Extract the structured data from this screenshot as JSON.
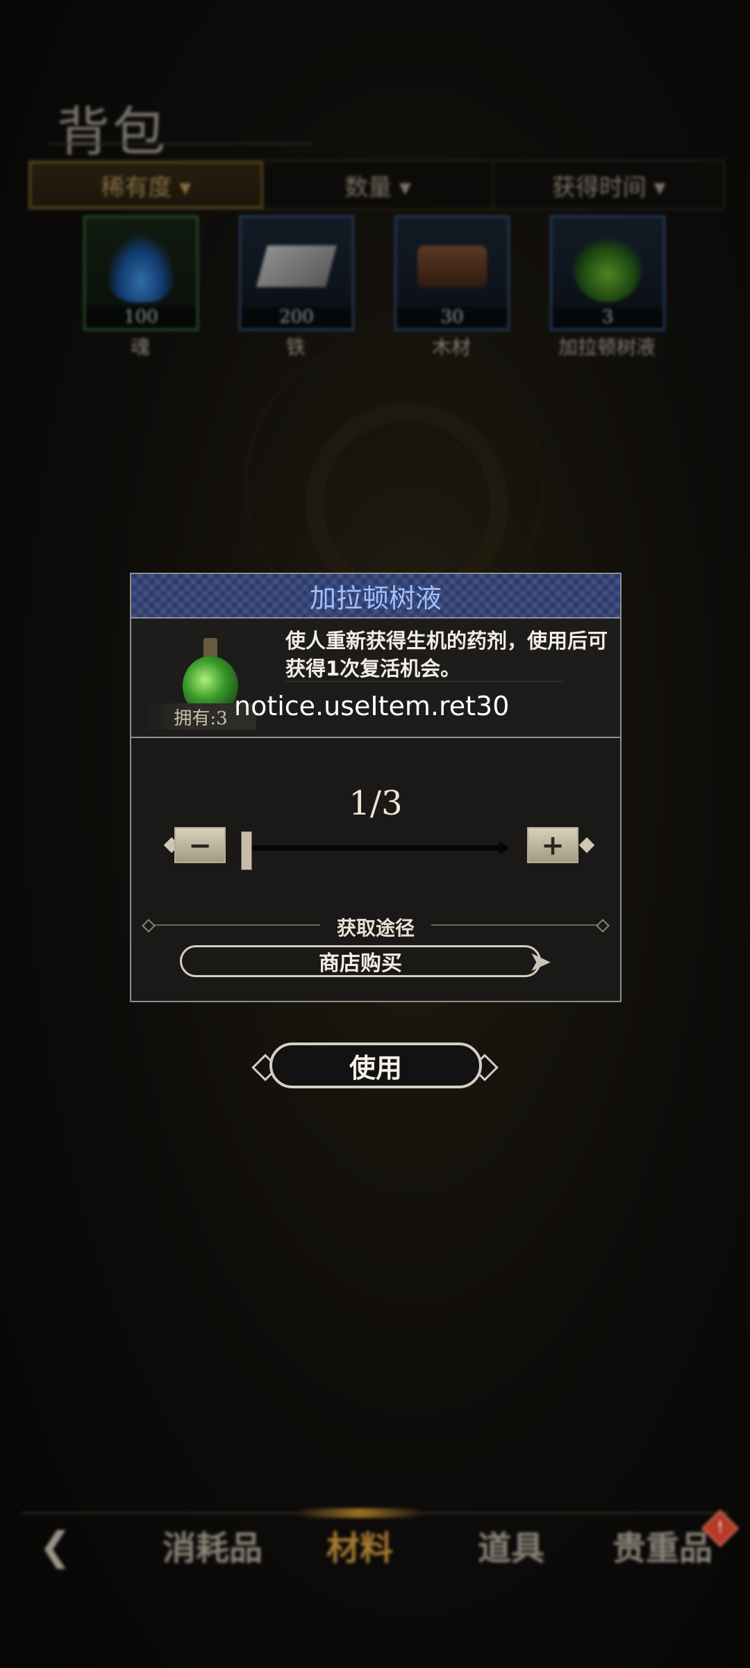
{
  "header": {
    "title": "背包"
  },
  "sort_tabs": [
    {
      "label": "稀有度 ▾",
      "active": true
    },
    {
      "label": "数量 ▾",
      "active": false
    },
    {
      "label": "获得时间 ▾",
      "active": false
    }
  ],
  "items": [
    {
      "count": "100",
      "name": "魂",
      "icon": "blue-flame-icon"
    },
    {
      "count": "200",
      "name": "铁",
      "icon": "iron-ingot-icon"
    },
    {
      "count": "30",
      "name": "木材",
      "icon": "wood-logs-icon"
    },
    {
      "count": "3",
      "name": "加拉顿树液",
      "icon": "potion-icon"
    }
  ],
  "modal": {
    "title": "加拉顿树液",
    "description": "使人重新获得生机的药剂，使用后可获得1次复活机会。",
    "owned": "拥有:3",
    "notice": "notice.useItem.ret30",
    "quantity": "1/3",
    "quantity_value": 1,
    "quantity_max": 3,
    "source_label": "获取途径",
    "shop_button": "商店购买"
  },
  "use_button": "使用",
  "bottom_nav": {
    "items": [
      "消耗品",
      "材料",
      "道具",
      "贵重品"
    ],
    "active": "材料",
    "badge": "!"
  },
  "colors": {
    "modal_header": "#2c3a6e",
    "modal_title": "#9fc0ff",
    "active_tab": "#a67a30",
    "badge": "#b43a2a"
  }
}
